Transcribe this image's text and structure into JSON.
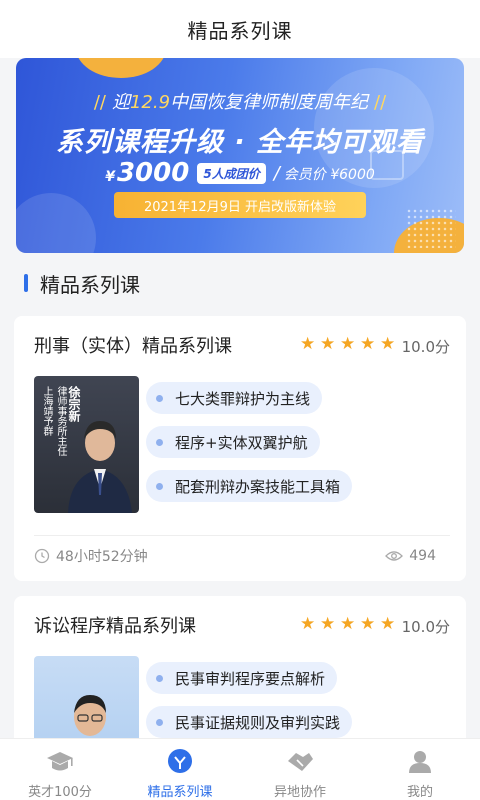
{
  "header": {
    "title": "精品系列课"
  },
  "banner": {
    "tagline_pre": "迎",
    "tagline_highlight": "12.9",
    "tagline_post": "中国恢复律师制度周年纪",
    "headline": "系列课程升级 · 全年均可观看",
    "price_yen": "¥",
    "price": "3000",
    "group_tag": "5人成团价",
    "member_price": "会员价 ¥6000",
    "date_text": "2021年12月9日  开启改版新体验"
  },
  "section": {
    "title": "精品系列课"
  },
  "courses": [
    {
      "title": "刑事（实体）精品系列课",
      "rating": 5,
      "score": "10.0分",
      "teacher_name": "徐宗新",
      "teacher_line1": "律师事务所主任",
      "teacher_line2": "上海靖予群",
      "tags": [
        "七大类罪辩护为主线",
        "程序+实体双翼护航",
        "配套刑辩办案技能工具箱"
      ],
      "duration": "48小时52分钟",
      "views": "494"
    },
    {
      "title": "诉讼程序精品系列课",
      "rating": 5,
      "score": "10.0分",
      "tags": [
        "民事审判程序要点解析",
        "民事证据规则及审判实践"
      ]
    }
  ],
  "tabs": [
    {
      "label": "英才100分",
      "icon": "graduation-cap-icon"
    },
    {
      "label": "精品系列课",
      "icon": "lightbulb-icon"
    },
    {
      "label": "异地协作",
      "icon": "handshake-icon"
    },
    {
      "label": "我的",
      "icon": "user-icon"
    }
  ],
  "colors": {
    "accent": "#2e6fe8",
    "star": "#f5a623",
    "tag_bg": "#e9f0fd"
  }
}
